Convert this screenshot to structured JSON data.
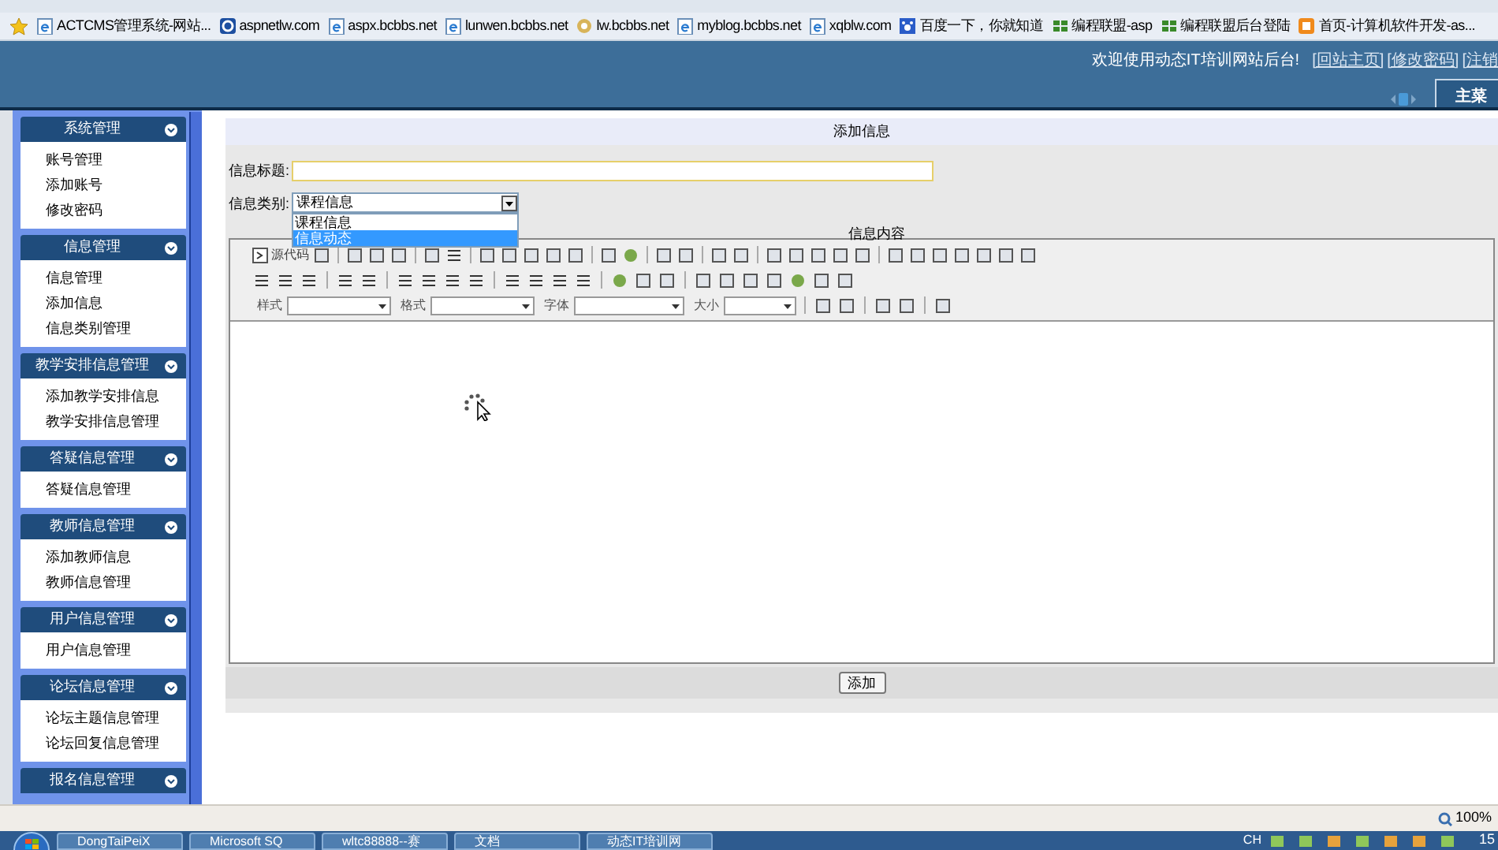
{
  "favorites_bar": [
    {
      "label": "ACTCMS管理系统-网站...",
      "kind": "ie"
    },
    {
      "label": "aspnetlw.com",
      "kind": "blue"
    },
    {
      "label": "aspx.bcbbs.net",
      "kind": "ie"
    },
    {
      "label": "lunwen.bcbbs.net",
      "kind": "ie"
    },
    {
      "label": "lw.bcbbs.net",
      "kind": "gear"
    },
    {
      "label": "myblog.bcbbs.net",
      "kind": "ie"
    },
    {
      "label": "xqblw.com",
      "kind": "ie"
    },
    {
      "label": "百度一下，你就知道",
      "kind": "paw"
    },
    {
      "label": "编程联盟-asp",
      "kind": "grid"
    },
    {
      "label": "编程联盟后台登陆",
      "kind": "grid"
    },
    {
      "label": "首页-计算机软件开发-as...",
      "kind": "orange"
    }
  ],
  "header": {
    "welcome": "欢迎使用动态IT培训网站后台!",
    "links": [
      "[回站主页]",
      "[修改密码]",
      "[注销"
    ],
    "menu_tab": "主菜"
  },
  "sidebar": [
    {
      "title": "系统管理",
      "items": [
        "账号管理",
        "添加账号",
        "修改密码"
      ]
    },
    {
      "title": "信息管理",
      "items": [
        "信息管理",
        "添加信息",
        "信息类别管理"
      ]
    },
    {
      "title": "教学安排信息管理",
      "items": [
        "添加教学安排信息",
        "教学安排信息管理"
      ]
    },
    {
      "title": "答疑信息管理",
      "items": [
        "答疑信息管理"
      ]
    },
    {
      "title": "教师信息管理",
      "items": [
        "添加教师信息",
        "教师信息管理"
      ]
    },
    {
      "title": "用户信息管理",
      "items": [
        "用户信息管理"
      ]
    },
    {
      "title": "论坛信息管理",
      "items": [
        "论坛主题信息管理",
        "论坛回复信息管理"
      ]
    },
    {
      "title": "报名信息管理"
    }
  ],
  "form": {
    "title": "添加信息",
    "title_label": "信息标题:",
    "category_label": "信息类别:",
    "category_value": "课程信息",
    "category_options": [
      {
        "label": "课程信息",
        "selected": false
      },
      {
        "label": "信息动态",
        "selected": true
      }
    ],
    "content_label": "信息内容",
    "editor": {
      "source_label": "源代码",
      "style_label": "样式",
      "format_label": "格式",
      "font_label": "字体",
      "size_label": "大小"
    },
    "submit": "添加"
  },
  "status_bar": {
    "zoom": "100%"
  },
  "taskbar": {
    "windows": [
      "DongTaiPeiX",
      "Microsoft SQ",
      "wltc88888--赛",
      "文档",
      "动态IT培训网"
    ],
    "tray_lang": "CH",
    "clock": "15"
  }
}
